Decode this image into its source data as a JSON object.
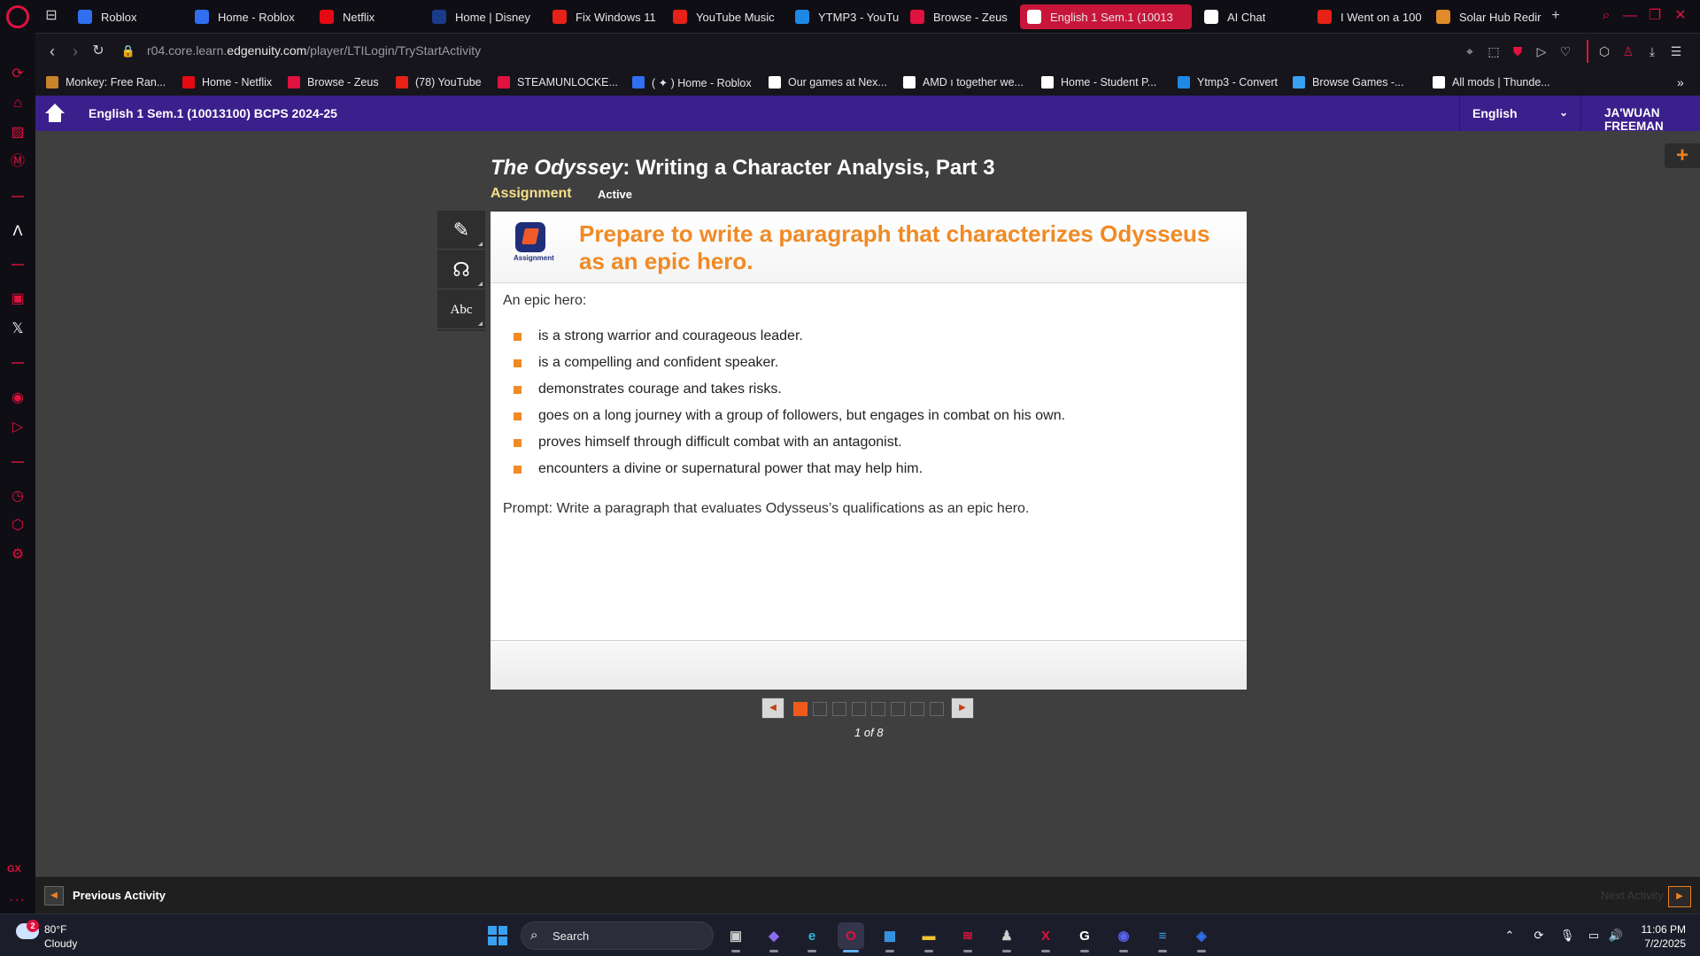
{
  "browser": {
    "tabs": [
      {
        "label": "Roblox",
        "icon": "roblox-icon",
        "color": "#2f6ff0"
      },
      {
        "label": "Home - Roblox",
        "icon": "roblox-icon",
        "color": "#2f6ff0"
      },
      {
        "label": "Netflix",
        "icon": "netflix-icon",
        "color": "#e50914"
      },
      {
        "label": "Home | Disney",
        "icon": "disney-icon",
        "color": "#1a3a8a"
      },
      {
        "label": "Fix Windows 11",
        "icon": "youtube-icon",
        "color": "#e62117"
      },
      {
        "label": "YouTube Music",
        "icon": "youtube-music-icon",
        "color": "#e62117"
      },
      {
        "label": "YTMP3 - YouTu",
        "icon": "ytmp3-icon",
        "color": "#1e88e5"
      },
      {
        "label": "Browse - Zeus",
        "icon": "zeus-icon",
        "color": "#e0123f"
      },
      {
        "label": "English 1 Sem.1 (10013",
        "icon": "edgenuity-icon",
        "color": "#ffffff",
        "active": true
      },
      {
        "label": "AI Chat",
        "icon": "ai-chat-icon",
        "color": "#ffffff"
      },
      {
        "label": "I Went on a 100",
        "icon": "youtube-icon",
        "color": "#e62117"
      },
      {
        "label": "Solar Hub Redir",
        "icon": "solar-hub-icon",
        "color": "#e08a2a"
      }
    ],
    "address": {
      "prefix": "r04.core.learn.",
      "host": "edgenuity.com",
      "path": "/player/LTILogin/TryStartActivity"
    },
    "bookmarks": [
      {
        "label": "Monkey: Free Ran...",
        "icon": "monkey-icon",
        "color": "#c8842a"
      },
      {
        "label": "Home - Netflix",
        "icon": "netflix-icon",
        "color": "#e50914"
      },
      {
        "label": "Browse - Zeus",
        "icon": "zeus-icon",
        "color": "#e0123f"
      },
      {
        "label": "(78) YouTube",
        "icon": "youtube-icon",
        "color": "#e62117"
      },
      {
        "label": "STEAMUNLOCKE...",
        "icon": "steamunlocked-icon",
        "color": "#e0123f"
      },
      {
        "label": "( ✦ ) Home - Roblox",
        "icon": "roblox-icon",
        "color": "#2f6ff0"
      },
      {
        "label": "Our games at Nex...",
        "icon": "page-icon",
        "color": "#ffffff"
      },
      {
        "label": "AMD ı together we...",
        "icon": "page-icon",
        "color": "#ffffff"
      },
      {
        "label": "Home - Student P...",
        "icon": "page-icon",
        "color": "#ffffff"
      },
      {
        "label": "Ytmp3 - Convert",
        "icon": "ytmp3-icon",
        "color": "#1e88e5"
      },
      {
        "label": "Browse Games -...",
        "icon": "gear-game-icon",
        "color": "#3aa0f0"
      },
      {
        "label": "All mods | Thunde...",
        "icon": "page-icon",
        "color": "#ffffff"
      }
    ]
  },
  "course": {
    "title": "English 1 Sem.1 (10013100) BCPS 2024-25",
    "language": "English",
    "user": "JA'WUAN FREEMAN"
  },
  "activity": {
    "title_italic": "The Odyssey",
    "title_rest": ": Writing a Character Analysis, Part 3",
    "type": "Assignment",
    "status": "Active"
  },
  "card": {
    "icon_label": "Assignment",
    "heading": "Prepare to write a paragraph that characterizes Odysseus as an epic hero.",
    "intro": "An epic hero:",
    "traits": [
      "is a strong warrior and courageous leader.",
      "is a compelling and confident speaker.",
      "demonstrates courage and takes risks.",
      "goes on a long journey with a group of followers, but engages in combat on his own.",
      "proves himself through difficult combat with an antagonist.",
      "encounters a divine or supernatural power that may help him."
    ],
    "prompt": "Prompt: Write a paragraph that evaluates Odysseus’s qualifications as an epic hero."
  },
  "pager": {
    "current": 1,
    "total": 8,
    "label": "1 of 8"
  },
  "nav": {
    "prev_label": "Previous Activity",
    "next_label": "Next Activity"
  },
  "taskbar": {
    "weather_temp": "80°F",
    "weather_desc": "Cloudy",
    "weather_badge": "2",
    "search_label": "Search",
    "time": "11:06 PM",
    "date": "7/2/2025",
    "apps": [
      {
        "name": "task-view-icon",
        "glyph": "▣",
        "color": "#cfcfcf"
      },
      {
        "name": "copilot-icon",
        "glyph": "◆",
        "color": "#8a6cf0"
      },
      {
        "name": "edge-icon",
        "glyph": "e",
        "color": "#2fb8e0"
      },
      {
        "name": "opera-gx-icon",
        "glyph": "O",
        "color": "#e0123f",
        "active": true
      },
      {
        "name": "microsoft-store-icon",
        "glyph": "▦",
        "color": "#3aa0f0"
      },
      {
        "name": "file-explorer-icon",
        "glyph": "▬",
        "color": "#f2c230"
      },
      {
        "name": "razer-icon",
        "glyph": "≋",
        "color": "#e0123f"
      },
      {
        "name": "game-app-icon",
        "glyph": "♟",
        "color": "#cfcfcf"
      },
      {
        "name": "xbox-style-icon",
        "glyph": "X",
        "color": "#e0123f"
      },
      {
        "name": "g-hub-icon",
        "glyph": "G",
        "color": "#ffffff"
      },
      {
        "name": "discord-icon",
        "glyph": "◉",
        "color": "#5865f2"
      },
      {
        "name": "notepad-icon",
        "glyph": "≡",
        "color": "#3aa0f0"
      },
      {
        "name": "roblox-icon",
        "glyph": "◈",
        "color": "#2f6ff0"
      }
    ]
  }
}
